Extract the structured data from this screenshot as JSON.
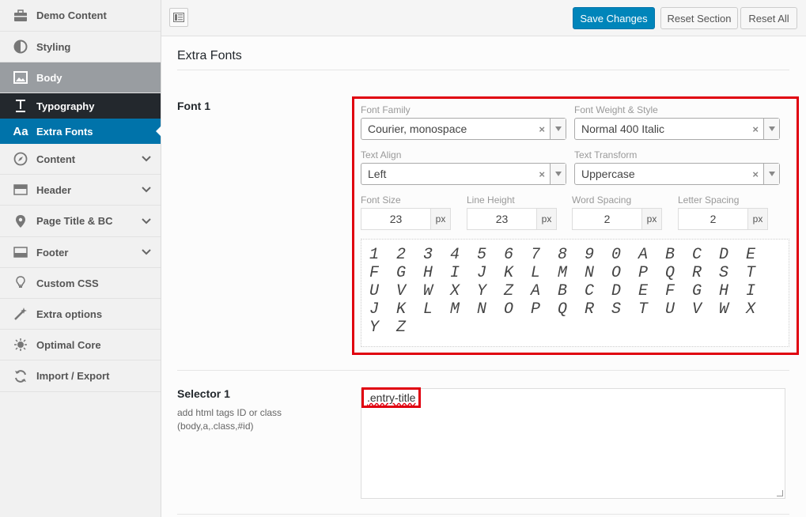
{
  "sidebar": {
    "items": [
      {
        "label": "Demo Content",
        "icon": "briefcase-icon"
      },
      {
        "label": "Styling",
        "icon": "contrast-icon"
      },
      {
        "label": "Body",
        "icon": "image-icon"
      },
      {
        "label": "Typography",
        "icon": "typography-icon"
      },
      {
        "label": "Extra Fonts",
        "icon": "font-aa-icon"
      },
      {
        "label": "Content",
        "icon": "compass-icon"
      },
      {
        "label": "Header",
        "icon": "header-icon"
      },
      {
        "label": "Page Title & BC",
        "icon": "location-pin-icon"
      },
      {
        "label": "Footer",
        "icon": "footer-icon"
      },
      {
        "label": "Custom CSS",
        "icon": "lightbulb-icon"
      },
      {
        "label": "Extra options",
        "icon": "magic-wand-icon"
      },
      {
        "label": "Optimal Core",
        "icon": "sparkle-bulb-icon"
      },
      {
        "label": "Import / Export",
        "icon": "refresh-icon"
      }
    ]
  },
  "toolbar": {
    "save_label": "Save Changes",
    "reset_section_label": "Reset Section",
    "reset_all_label": "Reset All"
  },
  "section": {
    "title": "Extra Fonts"
  },
  "font1": {
    "label": "Font 1",
    "font_family_label": "Font Family",
    "font_family_value": "Courier, monospace",
    "font_weight_label": "Font Weight & Style",
    "font_weight_value": "Normal 400 Italic",
    "text_align_label": "Text Align",
    "text_align_value": "Left",
    "text_transform_label": "Text Transform",
    "text_transform_value": "Uppercase",
    "font_size_label": "Font Size",
    "font_size_value": "23",
    "line_height_label": "Line Height",
    "line_height_value": "23",
    "word_spacing_label": "Word Spacing",
    "word_spacing_value": "2",
    "letter_spacing_label": "Letter Spacing",
    "letter_spacing_value": "2",
    "unit": "px",
    "clear_glyph": "×",
    "preview_chars": [
      "1",
      "2",
      "3",
      "4",
      "5",
      "6",
      "7",
      "8",
      "9",
      "0",
      "A",
      "B",
      "C",
      "D",
      "E",
      "F",
      "G",
      "H",
      "I",
      "J",
      "K",
      "L",
      "M",
      "N",
      "O",
      "P",
      "Q",
      "R",
      "S",
      "T",
      "U",
      "V",
      "W",
      "X",
      "Y",
      "Z",
      "A",
      "B",
      "C",
      "D",
      "E",
      "F",
      "G",
      "H",
      "I",
      "J",
      "K",
      "L",
      "M",
      "N",
      "O",
      "P",
      "Q",
      "R",
      "S",
      "T",
      "U",
      "V",
      "W",
      "X",
      "Y",
      "Z"
    ]
  },
  "selector1": {
    "label": "Selector 1",
    "description": "add html tags ID or class (body,a,.class,#id)",
    "value": ".entry-title"
  },
  "colors": {
    "accent": "#0085ba",
    "highlight": "#e0000f",
    "sidebar_active": "#23282d"
  }
}
